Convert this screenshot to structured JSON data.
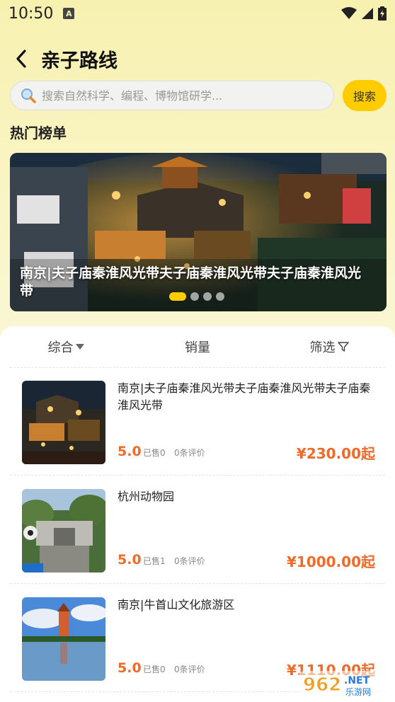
{
  "status_bar": {
    "time": "10:50",
    "a_badge": "A"
  },
  "header": {
    "title": "亲子路线",
    "back_icon": "chevron-left-icon"
  },
  "search": {
    "placeholder": "搜索自然科学、编程、博物馆研学...",
    "button_label": "搜索",
    "icon": "search-icon"
  },
  "hot_list": {
    "title": "热门榜单"
  },
  "banner": {
    "caption": "南京|夫子庙秦淮风光带夫子庙秦淮风光带夫子庙秦淮风光带",
    "dot_count": 4,
    "active_dot": 0
  },
  "sort_tabs": [
    {
      "label": "综合",
      "icon": "caret-down-icon"
    },
    {
      "label": "销量"
    },
    {
      "label": "筛选",
      "icon": "filter-icon"
    }
  ],
  "items": [
    {
      "title": "南京|夫子庙秦淮风光带夫子庙秦淮风光带夫子庙秦淮风光带",
      "rating": "5.0",
      "sold": "已售0",
      "reviews": "0条评价",
      "price": "¥230.00起"
    },
    {
      "title": "杭州动物园",
      "rating": "5.0",
      "sold": "已售1",
      "reviews": "0条评价",
      "price": "¥1000.00起"
    },
    {
      "title": "南京|牛首山文化旅游区",
      "rating": "5.0",
      "sold": "已售0",
      "reviews": "0条评价",
      "price": "¥1110.00起"
    }
  ],
  "colors": {
    "accent": "#ffcc00",
    "price": "#f06a2a",
    "header_bg": "#f7f1b0"
  }
}
